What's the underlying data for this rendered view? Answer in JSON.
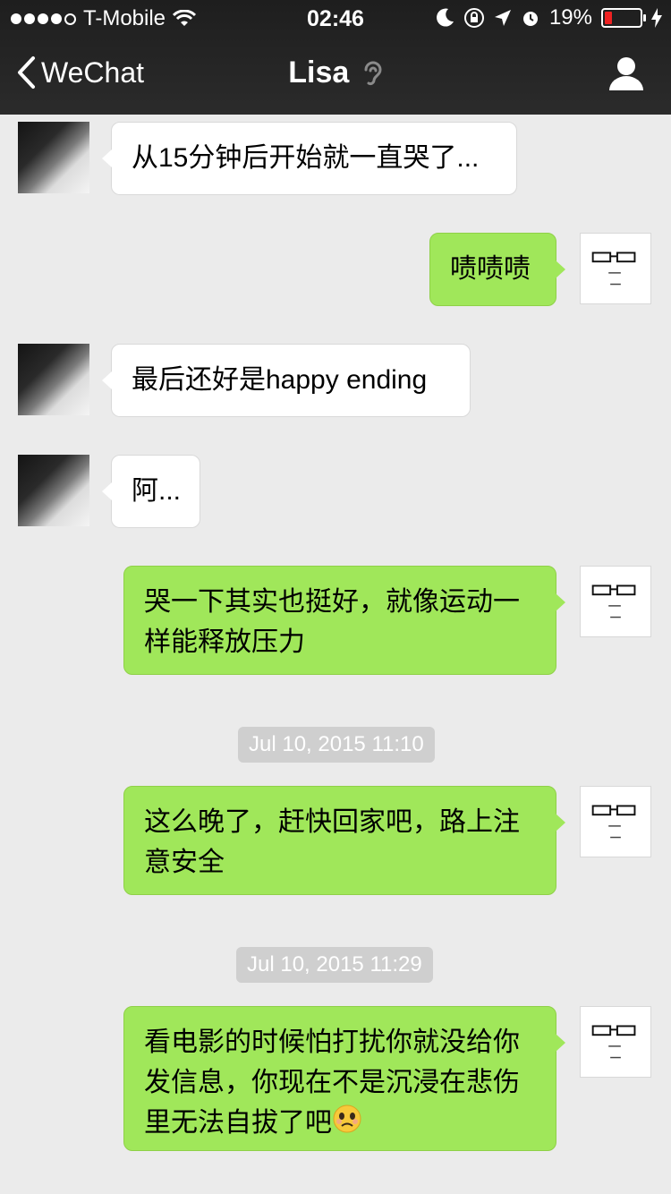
{
  "status_bar": {
    "carrier": "T-Mobile",
    "time": "02:46",
    "battery_percent": "19%",
    "battery_level": 0.19,
    "signal_bars": 4,
    "icons": [
      "wifi-icon",
      "moon-icon",
      "rotation-lock-icon",
      "location-icon",
      "alarm-icon",
      "battery-icon",
      "charging-icon"
    ]
  },
  "nav": {
    "back_label": "WeChat",
    "title": "Lisa",
    "icons": [
      "back-chevron-icon",
      "earpiece-icon",
      "profile-icon"
    ]
  },
  "messages": [
    {
      "sender": "Lisa",
      "text": "从15分钟后开始就一直哭了..."
    },
    {
      "sender": "me",
      "text": "啧啧啧"
    },
    {
      "sender": "Lisa",
      "text": "最后还好是happy ending"
    },
    {
      "sender": "Lisa",
      "text": "阿..."
    },
    {
      "sender": "me",
      "text": "哭一下其实也挺好，就像运动一样能释放压力"
    },
    {
      "timestamp": "Jul 10, 2015 11:10"
    },
    {
      "sender": "me",
      "text": "这么晚了，赶快回家吧，路上注意安全"
    },
    {
      "timestamp": "Jul 10, 2015 11:29"
    },
    {
      "sender": "me",
      "text": "看电影的时候怕打扰你就没给你发信息，你现在不是沉浸在悲伤里无法自拔了吧",
      "emoji": "worried-face-emoji"
    }
  ],
  "colors": {
    "header_bg": "#2b2b2b",
    "chat_bg": "#ebebeb",
    "sent_bubble": "#a0e75a",
    "received_bubble": "#ffffff",
    "timestamp_bg": "#cfcfcf"
  }
}
